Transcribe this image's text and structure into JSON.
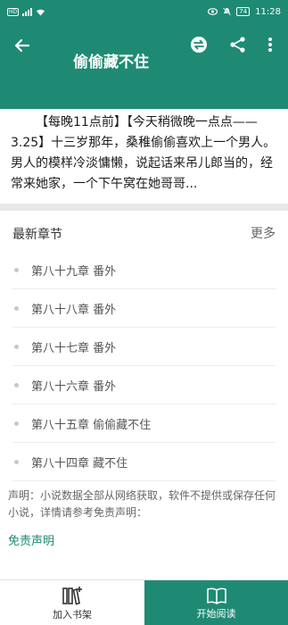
{
  "status_bar": {
    "signal_badge": "HD",
    "battery": "74",
    "time": "11:28"
  },
  "header": {
    "title": "偷偷藏不住",
    "icons": [
      "back-arrow-icon",
      "circle-swap-icon",
      "share-icon",
      "more-vert-icon"
    ]
  },
  "intro": {
    "text": "【每晚11点前】【今天稍微晚一点点——3.25】十三岁那年，桑稚偷偷喜欢上一个男人。男人的模样冷淡慵懒，说起话来吊儿郎当的，经常来她家，一个下午窝在她哥哥..."
  },
  "latest": {
    "title": "最新章节",
    "more": "更多",
    "chapters": [
      "第八十九章 番外",
      "第八十八章 番外",
      "第八十七章 番外",
      "第八十六章 番外",
      "第八十五章 偷偷藏不住",
      "第八十四章 藏不住"
    ]
  },
  "disclaimer": {
    "text": "声明：小说数据全部从网络获取，软件不提供或保存任何小说，详情请参考免责声明：",
    "link": "免责声明"
  },
  "bottom": {
    "add_shelf": "加入书架",
    "start_reading": "开始阅读"
  },
  "colors": {
    "primary": "#1f8a73",
    "divider": "#e8e8e8"
  }
}
